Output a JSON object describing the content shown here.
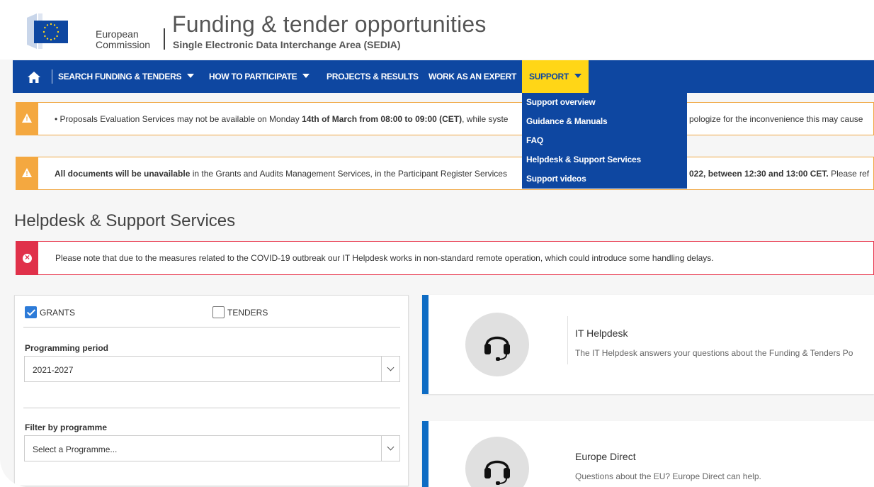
{
  "header": {
    "org_line1": "European",
    "org_line2": "Commission",
    "title": "Funding & tender opportunities",
    "subtitle": "Single Electronic Data Interchange Area (SEDIA)"
  },
  "nav": {
    "items": [
      {
        "label": "SEARCH FUNDING & TENDERS",
        "has_caret": true
      },
      {
        "label": "HOW TO PARTICIPATE",
        "has_caret": true
      },
      {
        "label": "PROJECTS & RESULTS",
        "has_caret": false
      },
      {
        "label": "WORK AS AN EXPERT",
        "has_caret": false
      },
      {
        "label": "SUPPORT",
        "has_caret": true,
        "active": true
      }
    ]
  },
  "support_menu": {
    "items": [
      "Support overview",
      "Guidance & Manuals",
      "FAQ",
      "Helpdesk & Support Services",
      "Support videos"
    ]
  },
  "alerts": [
    {
      "pre": "• Proposals Evaluation Services may not be available on Monday ",
      "bold": "14th of March from 08:00 to 09:00 (CET)",
      "post": ", while syste",
      "tail": "pologize for the inconvenience this may cause"
    },
    {
      "bold": "All documents will be unavailable",
      "post": " in the Grants and Audits Management Services, in the Participant Register Services",
      "tail_bold": "022, between 12:30 and 13:00 CET.",
      "tail": " Please ref"
    }
  ],
  "page_title": "Helpdesk & Support Services",
  "covid_notice": "Please note that due to the measures related to the COVID-19 outbreak our IT Helpdesk works in non-standard remote operation, which could introduce some handling delays.",
  "filters": {
    "grants_label": "GRANTS",
    "grants_checked": true,
    "tenders_label": "TENDERS",
    "tenders_checked": false,
    "programming_period_label": "Programming period",
    "programming_period_value": "2021-2027",
    "programme_label": "Filter by programme",
    "programme_placeholder": "Select a Programme..."
  },
  "cards": [
    {
      "title": "IT Helpdesk",
      "desc": "The IT Helpdesk answers your questions about the Funding & Tenders Po",
      "icon": "headset-icon"
    },
    {
      "title": "Europe Direct",
      "desc": "Questions about the EU? Europe Direct can help.",
      "icon": "headset-icon"
    }
  ],
  "colors": {
    "nav_blue": "#0e47a1",
    "active_yellow": "#ffd617",
    "warning_orange": "#f4a840",
    "error_red": "#e0314a",
    "card_accent": "#0e6cc4"
  }
}
